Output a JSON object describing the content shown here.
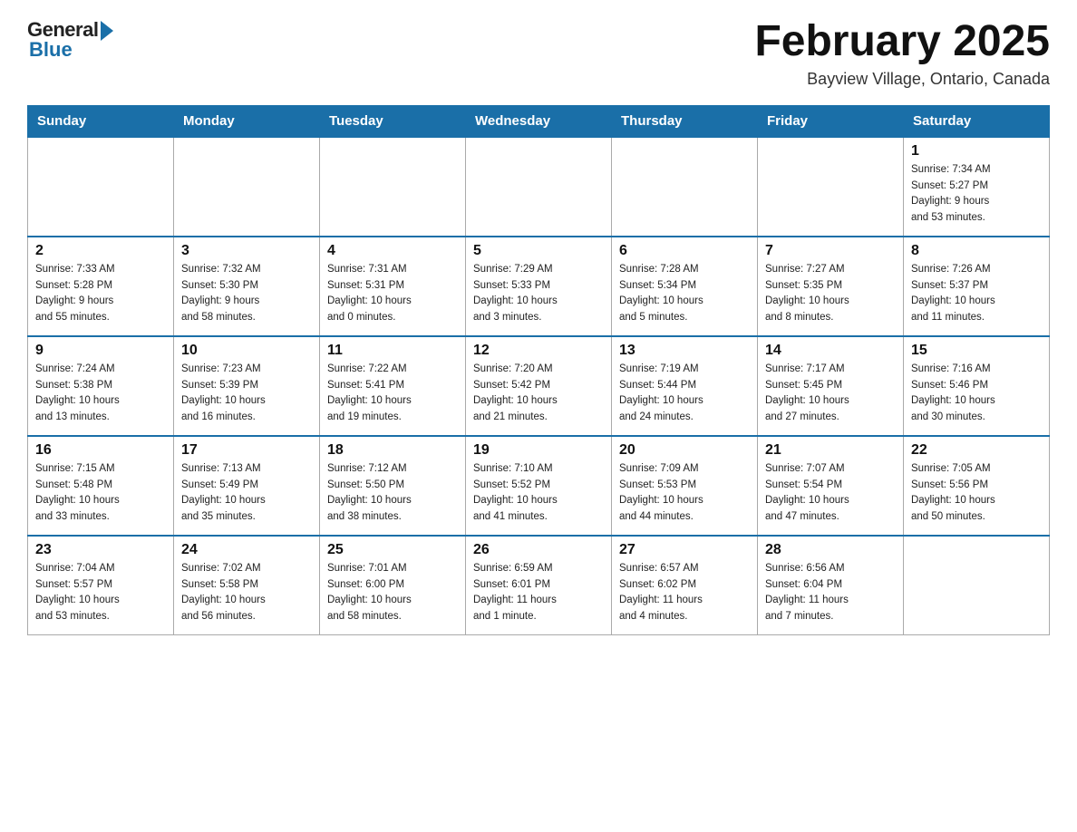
{
  "header": {
    "logo_general": "General",
    "logo_blue": "Blue",
    "month_title": "February 2025",
    "location": "Bayview Village, Ontario, Canada"
  },
  "weekdays": [
    "Sunday",
    "Monday",
    "Tuesday",
    "Wednesday",
    "Thursday",
    "Friday",
    "Saturday"
  ],
  "weeks": [
    [
      {
        "day": "",
        "info": ""
      },
      {
        "day": "",
        "info": ""
      },
      {
        "day": "",
        "info": ""
      },
      {
        "day": "",
        "info": ""
      },
      {
        "day": "",
        "info": ""
      },
      {
        "day": "",
        "info": ""
      },
      {
        "day": "1",
        "info": "Sunrise: 7:34 AM\nSunset: 5:27 PM\nDaylight: 9 hours\nand 53 minutes."
      }
    ],
    [
      {
        "day": "2",
        "info": "Sunrise: 7:33 AM\nSunset: 5:28 PM\nDaylight: 9 hours\nand 55 minutes."
      },
      {
        "day": "3",
        "info": "Sunrise: 7:32 AM\nSunset: 5:30 PM\nDaylight: 9 hours\nand 58 minutes."
      },
      {
        "day": "4",
        "info": "Sunrise: 7:31 AM\nSunset: 5:31 PM\nDaylight: 10 hours\nand 0 minutes."
      },
      {
        "day": "5",
        "info": "Sunrise: 7:29 AM\nSunset: 5:33 PM\nDaylight: 10 hours\nand 3 minutes."
      },
      {
        "day": "6",
        "info": "Sunrise: 7:28 AM\nSunset: 5:34 PM\nDaylight: 10 hours\nand 5 minutes."
      },
      {
        "day": "7",
        "info": "Sunrise: 7:27 AM\nSunset: 5:35 PM\nDaylight: 10 hours\nand 8 minutes."
      },
      {
        "day": "8",
        "info": "Sunrise: 7:26 AM\nSunset: 5:37 PM\nDaylight: 10 hours\nand 11 minutes."
      }
    ],
    [
      {
        "day": "9",
        "info": "Sunrise: 7:24 AM\nSunset: 5:38 PM\nDaylight: 10 hours\nand 13 minutes."
      },
      {
        "day": "10",
        "info": "Sunrise: 7:23 AM\nSunset: 5:39 PM\nDaylight: 10 hours\nand 16 minutes."
      },
      {
        "day": "11",
        "info": "Sunrise: 7:22 AM\nSunset: 5:41 PM\nDaylight: 10 hours\nand 19 minutes."
      },
      {
        "day": "12",
        "info": "Sunrise: 7:20 AM\nSunset: 5:42 PM\nDaylight: 10 hours\nand 21 minutes."
      },
      {
        "day": "13",
        "info": "Sunrise: 7:19 AM\nSunset: 5:44 PM\nDaylight: 10 hours\nand 24 minutes."
      },
      {
        "day": "14",
        "info": "Sunrise: 7:17 AM\nSunset: 5:45 PM\nDaylight: 10 hours\nand 27 minutes."
      },
      {
        "day": "15",
        "info": "Sunrise: 7:16 AM\nSunset: 5:46 PM\nDaylight: 10 hours\nand 30 minutes."
      }
    ],
    [
      {
        "day": "16",
        "info": "Sunrise: 7:15 AM\nSunset: 5:48 PM\nDaylight: 10 hours\nand 33 minutes."
      },
      {
        "day": "17",
        "info": "Sunrise: 7:13 AM\nSunset: 5:49 PM\nDaylight: 10 hours\nand 35 minutes."
      },
      {
        "day": "18",
        "info": "Sunrise: 7:12 AM\nSunset: 5:50 PM\nDaylight: 10 hours\nand 38 minutes."
      },
      {
        "day": "19",
        "info": "Sunrise: 7:10 AM\nSunset: 5:52 PM\nDaylight: 10 hours\nand 41 minutes."
      },
      {
        "day": "20",
        "info": "Sunrise: 7:09 AM\nSunset: 5:53 PM\nDaylight: 10 hours\nand 44 minutes."
      },
      {
        "day": "21",
        "info": "Sunrise: 7:07 AM\nSunset: 5:54 PM\nDaylight: 10 hours\nand 47 minutes."
      },
      {
        "day": "22",
        "info": "Sunrise: 7:05 AM\nSunset: 5:56 PM\nDaylight: 10 hours\nand 50 minutes."
      }
    ],
    [
      {
        "day": "23",
        "info": "Sunrise: 7:04 AM\nSunset: 5:57 PM\nDaylight: 10 hours\nand 53 minutes."
      },
      {
        "day": "24",
        "info": "Sunrise: 7:02 AM\nSunset: 5:58 PM\nDaylight: 10 hours\nand 56 minutes."
      },
      {
        "day": "25",
        "info": "Sunrise: 7:01 AM\nSunset: 6:00 PM\nDaylight: 10 hours\nand 58 minutes."
      },
      {
        "day": "26",
        "info": "Sunrise: 6:59 AM\nSunset: 6:01 PM\nDaylight: 11 hours\nand 1 minute."
      },
      {
        "day": "27",
        "info": "Sunrise: 6:57 AM\nSunset: 6:02 PM\nDaylight: 11 hours\nand 4 minutes."
      },
      {
        "day": "28",
        "info": "Sunrise: 6:56 AM\nSunset: 6:04 PM\nDaylight: 11 hours\nand 7 minutes."
      },
      {
        "day": "",
        "info": ""
      }
    ]
  ]
}
